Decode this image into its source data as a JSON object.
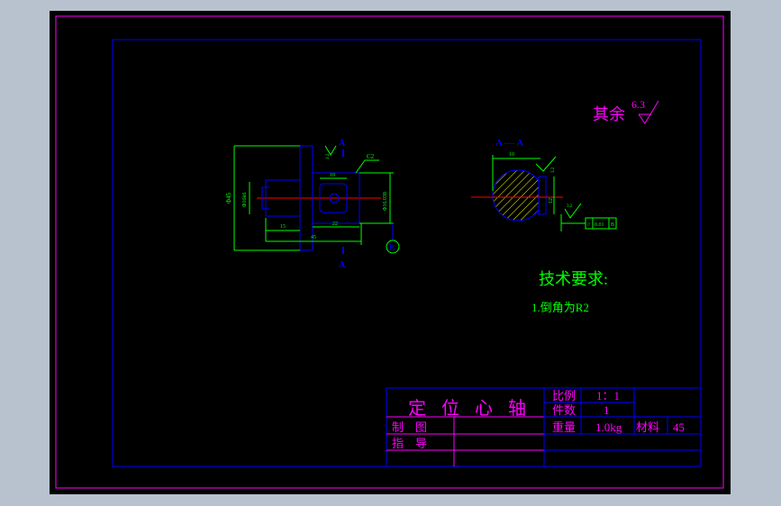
{
  "colors": {
    "background": "#000000",
    "outer_frame": "#ff00ff",
    "inner_frame": "#0000ff",
    "dimension": "#00ff00",
    "center_line": "#ff0000",
    "section_hatch": "#ffff00",
    "section_label": "#0000ff",
    "title_text": "#ff00ff"
  },
  "roughness": {
    "label": "其余",
    "value": "6.3"
  },
  "main_view": {
    "section_mark": "A",
    "chamfer": "C2",
    "dims": {
      "left_height": "Φ45",
      "shaft": "Φ16k6",
      "len_15": "15",
      "len_22": "22",
      "len_45": "45",
      "len_10": "10",
      "right_dim": "Φ16.038",
      "r_small": "3.2"
    },
    "datum": "B"
  },
  "section_view": {
    "title": "A — A",
    "width_dim": "10",
    "height_dim": "12",
    "roughness_1": "3.2",
    "roughness_2": "3.2",
    "tolerance": {
      "symbol": "//",
      "value": "0.01",
      "datum": "B"
    }
  },
  "tech_requirements": {
    "title": "技术要求:",
    "items": [
      "1.倒角为R2"
    ]
  },
  "title_block": {
    "part_name": "定 位 心 轴",
    "scale_label": "比例",
    "scale_value": "1：1",
    "qty_label": "件数",
    "qty_value": "1",
    "weight_label": "重量",
    "weight_value": "1.0kg",
    "material_label": "材料",
    "material_value": "45",
    "drawn_label": "制　图",
    "guide_label": "指　导"
  }
}
